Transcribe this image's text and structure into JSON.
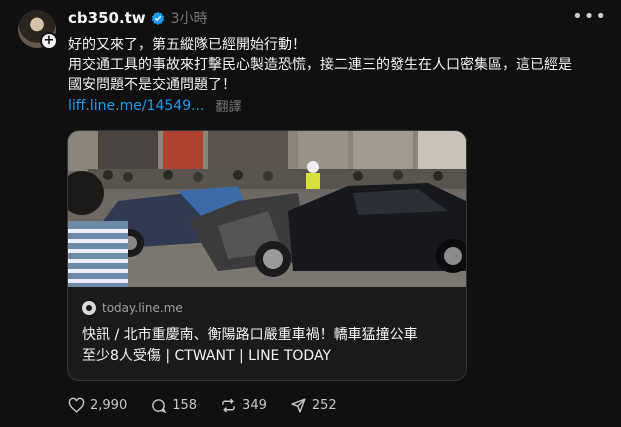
{
  "post": {
    "username": "cb350.tw",
    "timestamp": "3小時",
    "more_icon": "more-horizontal-icon",
    "lines": [
      "好的又來了，第五縱隊已經開始行動！",
      "用交通工具的事故來打擊民心製造恐慌，接二連三的發生在人口密集區，這已經是",
      "國安問題不是交通問題了！"
    ],
    "link_text": "liff.line.me/14549...",
    "translate_label": "翻譯"
  },
  "card": {
    "domain": "today.line.me",
    "title_line1": "快訊 / 北市重慶南、衡陽路口嚴重車禍！轎車猛撞公車",
    "title_line2": "至少8人受傷 | CTWANT | LINE TODAY"
  },
  "actions": {
    "likes": "2,990",
    "comments": "158",
    "reposts": "349",
    "shares": "252"
  },
  "colors": {
    "background": "#101010",
    "link": "#1d9bf0",
    "verified": "#1d9bf0",
    "muted": "#777777"
  }
}
